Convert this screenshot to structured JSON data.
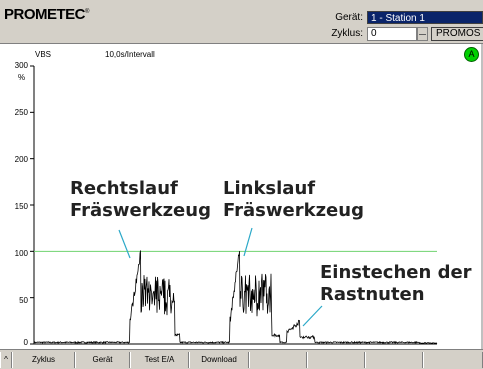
{
  "header": {
    "logo_text": "PROMETEC",
    "logo_mark": "®",
    "device_label": "Gerät:",
    "device_value": "1 - Station 1",
    "cycle_label": "Zyklus:",
    "cycle_value": "0",
    "promos_label": "PROMOS"
  },
  "status": {
    "led_label": "A",
    "led_color": "#00d000"
  },
  "chart_area": {
    "signal_label": "VBS",
    "interval_label": "10,0s/Intervall",
    "unit_label": "%"
  },
  "annotations": {
    "right_run_line1": "Rechtslauf",
    "right_run_line2": "Fräswerkzeug",
    "left_run_line1": "Linkslauf",
    "left_run_line2": "Fräswerkzeug",
    "groove_line1": "Einstechen der",
    "groove_line2": "Rastnuten"
  },
  "chart_data": {
    "type": "line",
    "title": "",
    "xlabel": "",
    "ylabel": "%",
    "ylim": [
      0,
      300
    ],
    "yticks": [
      "300",
      "250",
      "200",
      "150",
      "100",
      "50",
      "0"
    ],
    "threshold": 100,
    "threshold_color": "#6fd36f",
    "series_color": "#000000"
  },
  "tabs": {
    "items": [
      "^",
      "Zyklus",
      "Gerät",
      "Test E/A",
      "Download",
      "",
      "",
      "",
      ""
    ]
  }
}
